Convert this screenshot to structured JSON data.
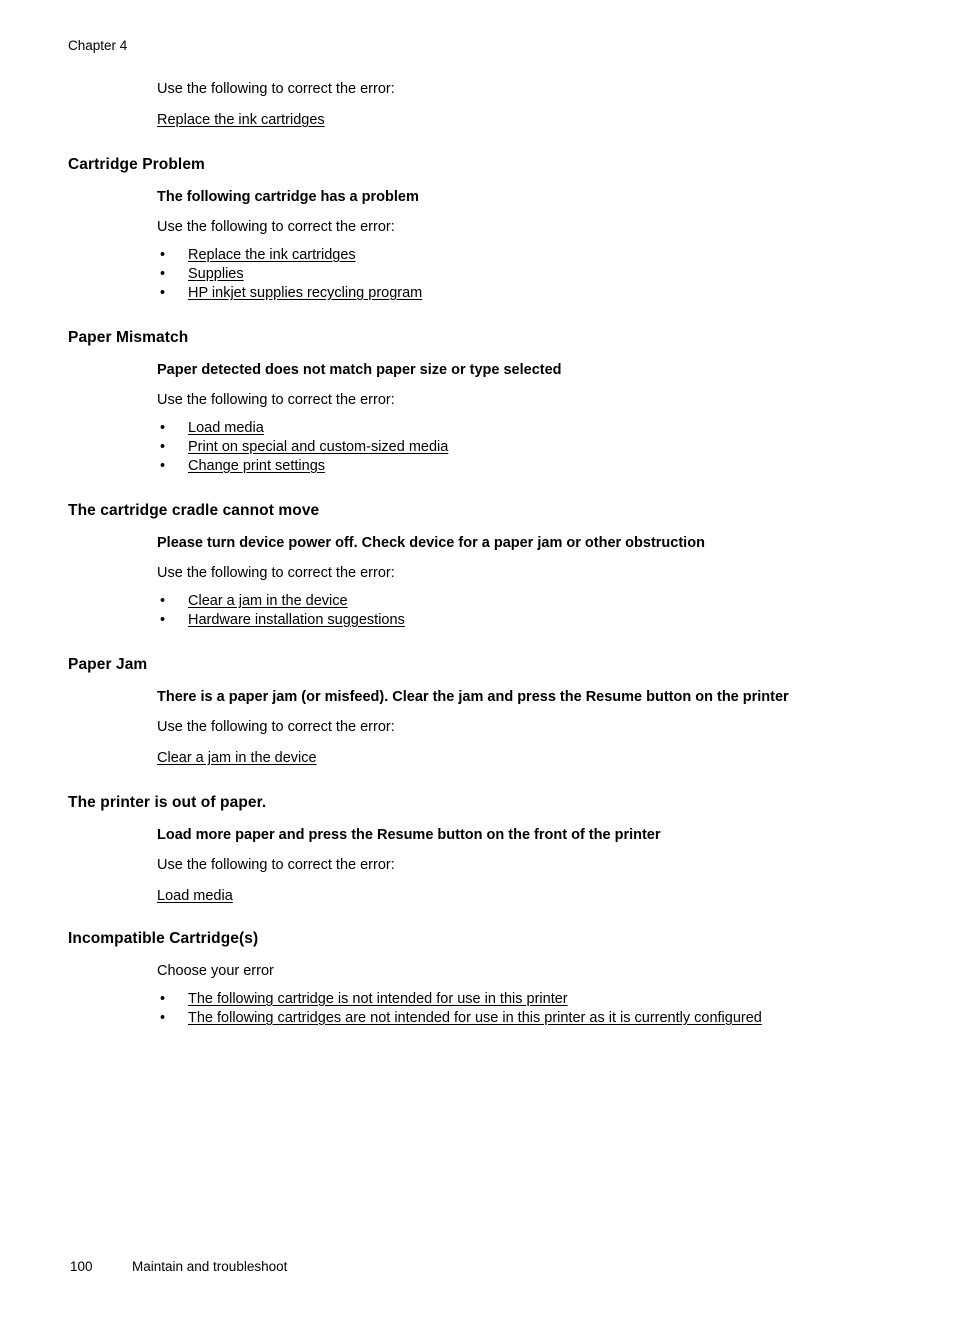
{
  "header": {
    "chapter": "Chapter 4"
  },
  "lead": {
    "intro": "Use the following to correct the error:",
    "link": "Replace the ink cartridges"
  },
  "common": {
    "intro_line": "Use the following to correct the error:",
    "bullet_glyph": "•"
  },
  "sections": [
    {
      "title": "Cartridge Problem",
      "sub_heading": "The following cartridge has a problem",
      "intro": "Use the following to correct the error:",
      "links": [
        "Replace the ink cartridges",
        "Supplies",
        "HP inkjet supplies recycling program"
      ]
    },
    {
      "title": "Paper Mismatch",
      "sub_heading": "Paper detected does not match paper size or type selected",
      "intro": "Use the following to correct the error:",
      "links": [
        "Load media",
        "Print on special and custom-sized media",
        "Change print settings"
      ]
    },
    {
      "title": "The cartridge cradle cannot move",
      "sub_heading": "Please turn device power off. Check device for a paper jam or other obstruction",
      "intro": "Use the following to correct the error:",
      "links": [
        "Clear a jam in the device",
        "Hardware installation suggestions"
      ]
    },
    {
      "title": "Paper Jam",
      "sub_heading": "There is a paper jam (or misfeed). Clear the jam and press the Resume button on the printer",
      "intro": "Use the following to correct the error:",
      "bare_link": "Clear a jam in the device"
    },
    {
      "title": "The printer is out of paper.",
      "sub_heading": "Load more paper and press the Resume button on the front of the printer",
      "intro": "Use the following to correct the error:",
      "bare_link": "Load media"
    },
    {
      "title": "Incompatible Cartridge(s)",
      "intro": "Choose your error",
      "links": [
        "The following cartridge is not intended for use in this printer",
        "The following cartridges are not intended for use in this printer as it is currently configured"
      ]
    }
  ],
  "footer": {
    "page_number": "100",
    "label": "Maintain and troubleshoot"
  }
}
